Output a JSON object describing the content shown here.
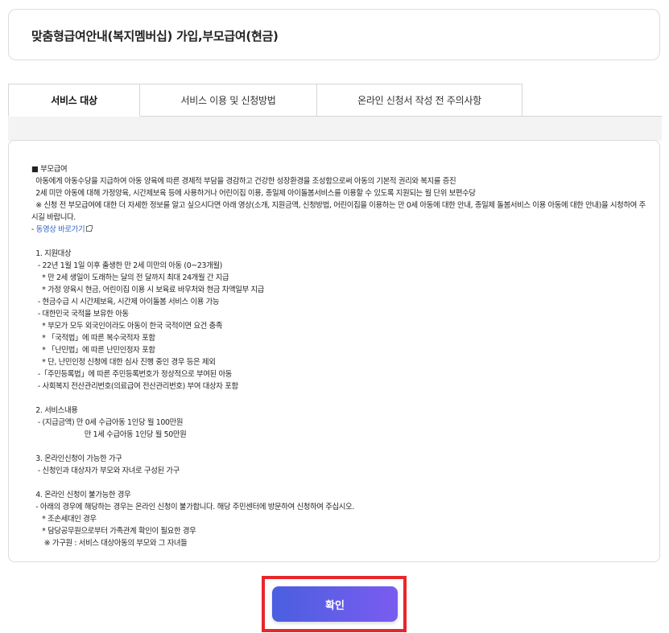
{
  "header": {
    "title": "맞춤형급여안내(복지멤버십) 가입,부모급여(현금)"
  },
  "tabs": [
    {
      "label": "서비스 대상",
      "active": true
    },
    {
      "label": "서비스 이용 및 신청방법",
      "active": false
    },
    {
      "label": "온라인 신청서 작성 전 주의사항",
      "active": false
    }
  ],
  "content": {
    "lines": [
      "■ 부모급여",
      "  아동에게 아동수당을 지급하여 아동 양육에 따른 경제적 부담을 경감하고 건강한 성장환경을 조성함으로써 아동의 기본적 권리와 복지를 증진",
      "  2세 미만 아동에 대해 가정양육, 시간제보육 등에 사용하거나 어린이집 이용, 종일제 아이돌봄서비스를 이용할 수 있도록 지원되는 월 단위 보편수당",
      "  ※ 신청 전 부모급여에 대한 더 자세한 정보를 알고 싶으시다면 아래 영상(소개, 지원금액, 신청방법, 어린이집을 이용하는 만 0세 아동에 대한 안내, 종일제 돌봄서비스 이용 아동에 대한 안내)을 시청하여 주시길 바랍니다.",
      "- ",
      "",
      "  1. 지원대상",
      "   - 22년 1월 1일 이후 출생한 만 2세 미만의 아동 (0~23개월)",
      "     * 만 2세 생일이 도래하는 달의 전 달까지 최대 24개월 간 지급",
      "     * 가정 양육시 현금, 어린이집 이용 시 보육료 바우처와 현금 차액일부 지급",
      "   - 현금수급 시 시간제보육, 시간제 아이돌봄 서비스 이용 가능",
      "   - 대한민국 국적을 보유한 아동",
      "     * 부모가 모두 외국인이라도 아동이 한국 국적이면 요건 충족",
      "     * 「국적법」에 따른 복수국적자 포함",
      "     * 「난민법」에 따른 난민인정자 포함",
      "     * 단, 난민인정 신청에 대한 심사 진행 중인 경우 등은 제외",
      "   -「주민등록법」에 따른 주민등록번호가 정상적으로 부여된 아동",
      "   - 사회복지 전산관리번호(의료급여 전산관리번호) 부여 대상자 포함",
      "",
      "  2. 서비스내용",
      "   - (지급금액) 만 0세 수급아동 1인당 월 100만원",
      "                         만 1세 수급아동 1인당 월 50만원",
      "",
      "  3. 온라인신청이 가능한 가구",
      "   - 신청인과 대상자가 부모와 자녀로 구성된 가구",
      "",
      "  4. 온라인 신청이 불가능한 경우",
      "  - 아래의 경우에 해당하는 경우는 온라인 신청이 불가합니다. 해당 주민센터에 방문하여 신청하여 주십시오.",
      "     * 조손세대인 경우",
      "     * 담당공무원으로부터 가족관계 확인이 필요한 경우",
      "      ※ 가구원 : 서비스 대상아동의 부모와 그 자녀들"
    ],
    "video_link": "동영상 바로가기"
  },
  "confirm_button": {
    "label": "확인"
  }
}
